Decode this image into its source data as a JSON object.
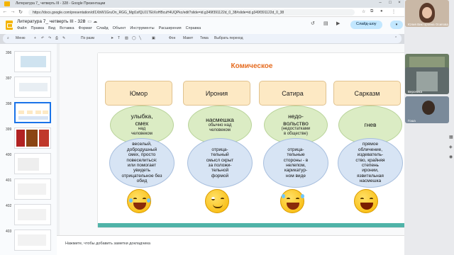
{
  "browser": {
    "tab_title": "Литература 7_ четверть III - 328 - Google Презентации",
    "url": "https://docs.google.com/presentation/d/1XbW1GruOn_RGG_Mgt1sfQL01TEtXoHBcuH4UQPkc/edit?slide=id.g349f391122d_0_38#slide=id.g349f391122d_0_38",
    "back": "←",
    "forward": "→",
    "reload": "↻"
  },
  "doc": {
    "title": "Литература 7_ четверть III - 328",
    "menu": [
      "Файл",
      "Правка",
      "Вид",
      "Вставка",
      "Формат",
      "Слайд",
      "Объект",
      "Инструменты",
      "Расширения",
      "Справка"
    ],
    "slideshow_label": "Слайд-шоу",
    "share_label": "▾"
  },
  "toolbar": {
    "menu_label": "Меню",
    "fit_label": "По разм",
    "bg_label": "Фон",
    "layout_label": "Макет",
    "theme_label": "Тема",
    "transition_label": "Выбрать переход"
  },
  "filmstrip": [
    {
      "num": "396"
    },
    {
      "num": "397"
    },
    {
      "num": "398",
      "active": true
    },
    {
      "num": "399"
    },
    {
      "num": "400"
    },
    {
      "num": "401"
    },
    {
      "num": "402"
    },
    {
      "num": "403"
    }
  ],
  "slide": {
    "title": "Комическое",
    "columns": [
      {
        "category": "Юмор",
        "green_big": "улыбка,\nсмех",
        "green_small": "над\nчеловеком",
        "blue": "веселый,\nдобродушный\nсмех, просто\nповеселиться:\nили помогает\nувидеть\nотрицательное без обид"
      },
      {
        "category": "Ирония",
        "green_big": "насмешка",
        "green_small": "обычно над\nчеловеком",
        "blue": "отрица-\nтельный\nсмысл скрыт\nза положи-\nтельной\nформой"
      },
      {
        "category": "Сатира",
        "green_big": "недо-\nвольство",
        "green_small": "(недостатками\nв обществе)",
        "blue": "отрица-\nтельные\nстороны - в\nнелепом,\nкарикатур-\nном виде"
      },
      {
        "category": "Сарказм",
        "green_big": "гнев",
        "green_small": "",
        "blue": "прямое\nобличение,\nиздеватель-\nство, крайняя\nстепень\nиронии,\nязвительная\nнасмешка"
      }
    ]
  },
  "notes": {
    "placeholder": "Нажмите, чтобы добавить заметки докладчика"
  },
  "participants": [
    {
      "name": "Юлия Викторовна Осипова"
    },
    {
      "name": "Зоя Хан"
    },
    {
      "name": "Вероника"
    },
    {
      "name": "Гоша"
    }
  ]
}
